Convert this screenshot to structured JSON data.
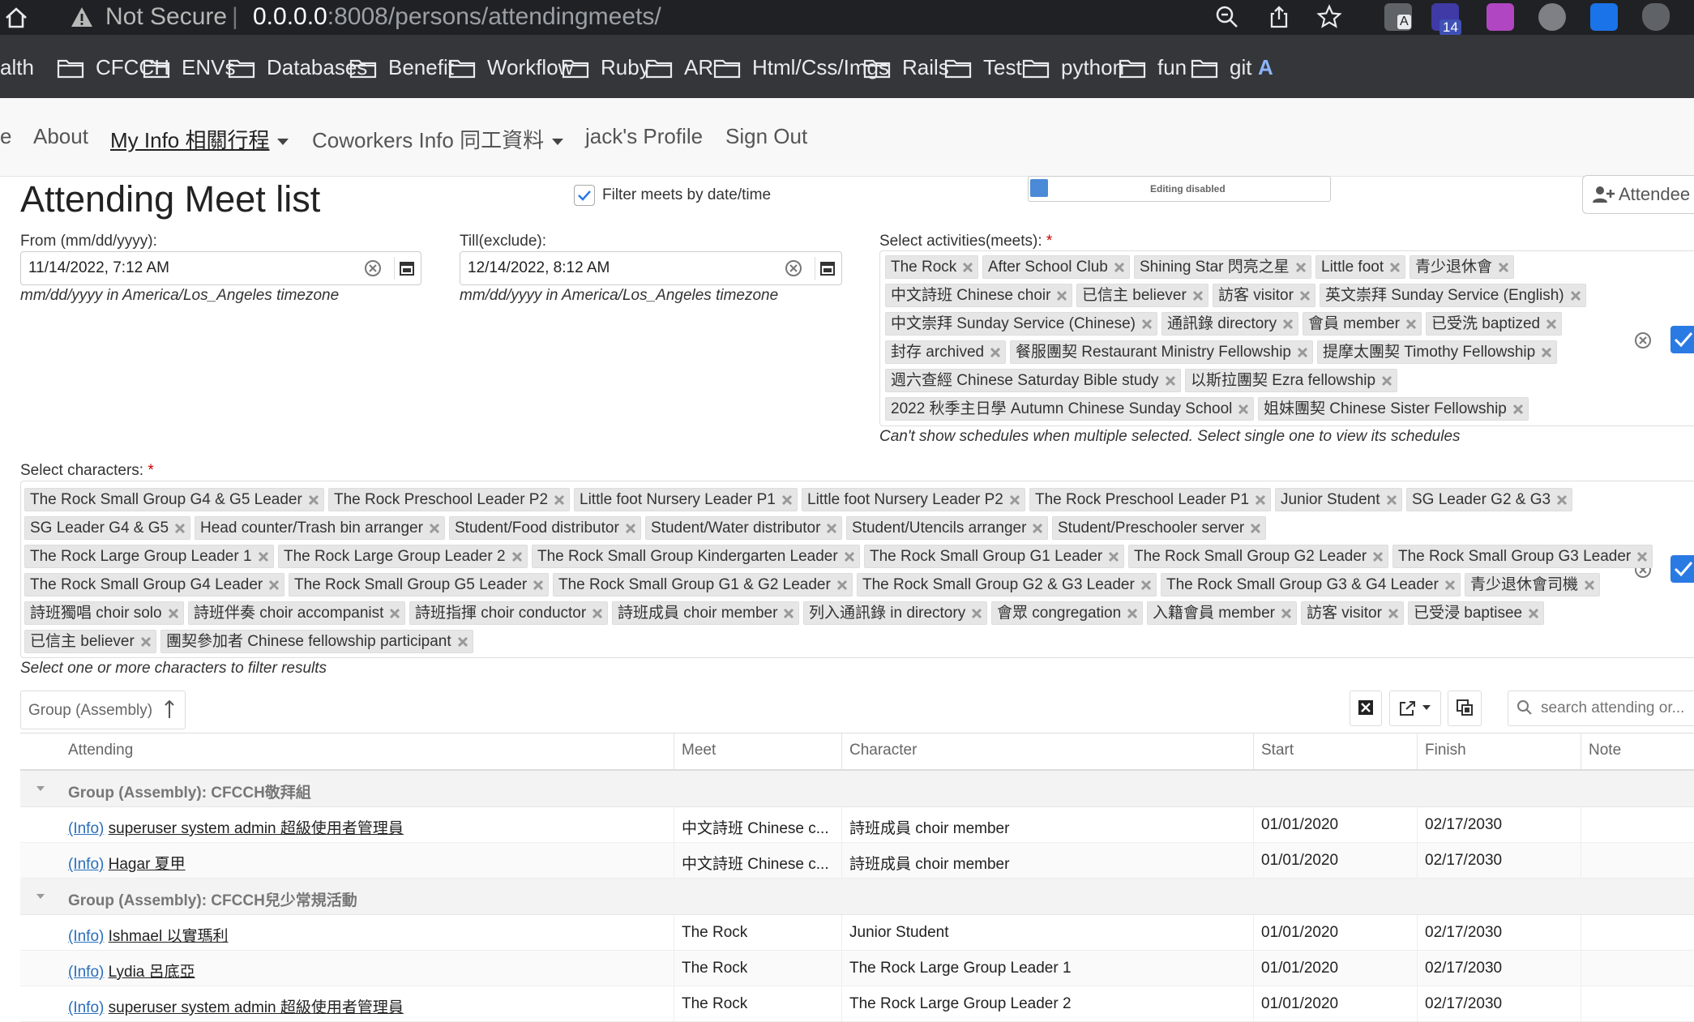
{
  "browser": {
    "not_secure": "Not Secure",
    "url_host": "0.0.0.0",
    "url_rest": ":8008/persons/attendingmeets/",
    "ext_badge": "14",
    "ext_letter": "A",
    "bookmarks_partial": "alth",
    "bookmarks": [
      "CFCCH",
      "ENVs",
      "Databases",
      "Benefit",
      "Workflow",
      "Ruby",
      "AR",
      "Html/Css/Imgs",
      "Rails",
      "Test",
      "python",
      "fun",
      "git"
    ],
    "bookmark_edge": "A"
  },
  "nav": {
    "partial": "e",
    "about": "About",
    "my_info": "My Info 相關行程",
    "coworkers": "Coworkers Info 同工資料",
    "profile": "jack's Profile",
    "signout": "Sign Out"
  },
  "page": {
    "title": "Attending Meet list",
    "filter_label": "Filter meets by date/time",
    "editing": "Editing disabled",
    "attendee_button": "Attendee",
    "from_label": "From (mm/dd/yyyy):",
    "from_value": "11/14/2022, 7:12 AM",
    "till_label": "Till(exclude):",
    "till_value": "12/14/2022, 8:12 AM",
    "tz_hint": "mm/dd/yyyy in America/Los_Angeles timezone",
    "activities_label": "Select activities(meets):",
    "required_mark": "*",
    "activities_hint": "Can't show schedules when multiple selected. Select single one to view its schedules",
    "characters_label": "Select characters:",
    "characters_hint": "Select one or more characters to filter results",
    "group_by": "Group (Assembly)",
    "search_placeholder": "search attending or..."
  },
  "activities": [
    "The Rock",
    "After School Club",
    "Shining Star 閃亮之星",
    "Little foot",
    "青少退休會",
    "中文詩班 Chinese choir",
    "已信主 believer",
    "訪客 visitor",
    "英文崇拜 Sunday Service (English)",
    "中文崇拜 Sunday Service (Chinese)",
    "通訊錄 directory",
    "會員 member",
    "已受洗 baptized",
    "封存 archived",
    "餐服團契 Restaurant Ministry Fellowship",
    "提摩太團契 Timothy Fellowship",
    "週六查經 Chinese Saturday Bible study",
    "以斯拉團契 Ezra fellowship",
    "2022 秋季主日學 Autumn Chinese Sunday School",
    "姐妹團契 Chinese Sister Fellowship"
  ],
  "characters": [
    "The Rock Small Group G4 & G5 Leader",
    "The Rock Preschool Leader P2",
    "Little foot Nursery Leader P1",
    "Little foot Nursery Leader P2",
    "The Rock Preschool Leader P1",
    "Junior Student",
    "SG Leader G2 & G3",
    "SG Leader G4 & G5",
    "Head counter/Trash bin arranger",
    "Student/Food distributor",
    "Student/Water distributor",
    "Student/Utencils arranger",
    "Student/Preschooler server",
    "The Rock Large Group Leader 1",
    "The Rock Large Group Leader 2",
    "The Rock Small Group Kindergarten Leader",
    "The Rock Small Group G1 Leader",
    "The Rock Small Group G2 Leader",
    "The Rock Small Group G3 Leader",
    "The Rock Small Group G4 Leader",
    "The Rock Small Group G5 Leader",
    "The Rock Small Group G1 & G2 Leader",
    "The Rock Small Group G2 & G3 Leader",
    "The Rock Small Group G3 & G4 Leader",
    "青少退休會司機",
    "詩班獨唱 choir solo",
    "詩班伴奏 choir accompanist",
    "詩班指揮 choir conductor",
    "詩班成員 choir member",
    "列入通訊錄 in directory",
    "會眾 congregation",
    "入籍會員 member",
    "訪客 visitor",
    "已受浸 baptisee",
    "已信主 believer",
    "團契參加者 Chinese fellowship participant"
  ],
  "grid": {
    "columns": [
      "Attending",
      "Meet",
      "Character",
      "Start",
      "Finish",
      "Note"
    ],
    "info_label": "(Info)",
    "groups": [
      {
        "title": "Group (Assembly): CFCCH敬拜組",
        "rows": [
          {
            "person": "superuser system admin 超級使用者管理員",
            "meet": "中文詩班 Chinese c...",
            "character": "詩班成員 choir member",
            "start": "01/01/2020",
            "finish": "02/17/2030",
            "note": ""
          },
          {
            "person": "Hagar 夏甲",
            "meet": "中文詩班 Chinese c...",
            "character": "詩班成員 choir member",
            "start": "01/01/2020",
            "finish": "02/17/2030",
            "note": ""
          }
        ]
      },
      {
        "title": "Group (Assembly): CFCCH兒少常規活動",
        "rows": [
          {
            "person": "Ishmael 以實瑪利",
            "meet": "The Rock",
            "character": "Junior Student",
            "start": "01/01/2020",
            "finish": "02/17/2030",
            "note": ""
          },
          {
            "person": "Lydia 呂底亞",
            "meet": "The Rock",
            "character": "The Rock Large Group Leader 1",
            "start": "01/01/2020",
            "finish": "02/17/2030",
            "note": ""
          },
          {
            "person": "superuser system admin 超級使用者管理員",
            "meet": "The Rock",
            "character": "The Rock Large Group Leader 2",
            "start": "01/01/2020",
            "finish": "02/17/2030",
            "note": ""
          }
        ]
      }
    ]
  },
  "colors": {
    "chrome_dark": "#202124",
    "bookmark_bar": "#35363a",
    "accent_blue": "#2a7ae4",
    "link": "#2a6ebb",
    "required": "#cc0000"
  }
}
